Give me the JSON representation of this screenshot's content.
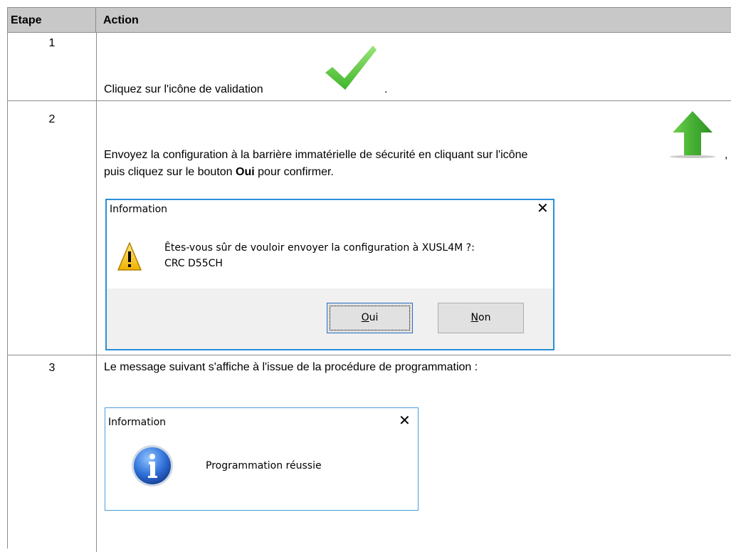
{
  "table": {
    "headers": [
      "Etape",
      "Action"
    ],
    "steps": [
      {
        "number": "1",
        "text_before": "Cliquez sur l'icône de validation",
        "text_after": ".",
        "icon": "green-checkmark-icon"
      },
      {
        "number": "2",
        "line1": "Envoyez la configuration à la barrière immatérielle de sécurité en cliquant sur l'icône",
        "line1_after": ",",
        "line2_before": "puis cliquez sur le bouton",
        "line2_bold": "Oui",
        "line2_after": "pour confirmer.",
        "icon": "green-up-arrow-icon",
        "dialog": {
          "title": "Information",
          "close": "✕",
          "icon": "warning-icon",
          "message_line1": "Êtes-vous sûr de vouloir envoyer la configuration à XUSL4M ?:",
          "message_line2": "CRC D55CH",
          "buttons": [
            {
              "mnemonic": "O",
              "rest": "ui"
            },
            {
              "mnemonic": "N",
              "rest": "on"
            }
          ]
        }
      },
      {
        "number": "3",
        "text": "Le message suivant s'affiche à l'issue de la procédure de programmation :",
        "dialog": {
          "title": "Information",
          "close": "✕",
          "icon": "info-icon",
          "message": "Programmation réussie"
        }
      }
    ]
  },
  "colors": {
    "header_bg": "#c8c8c8",
    "border": "#8c8c8c",
    "dialog_border": "#2b8fd6",
    "check_green": "#5fcc3d",
    "arrow_green": "#46b035"
  }
}
